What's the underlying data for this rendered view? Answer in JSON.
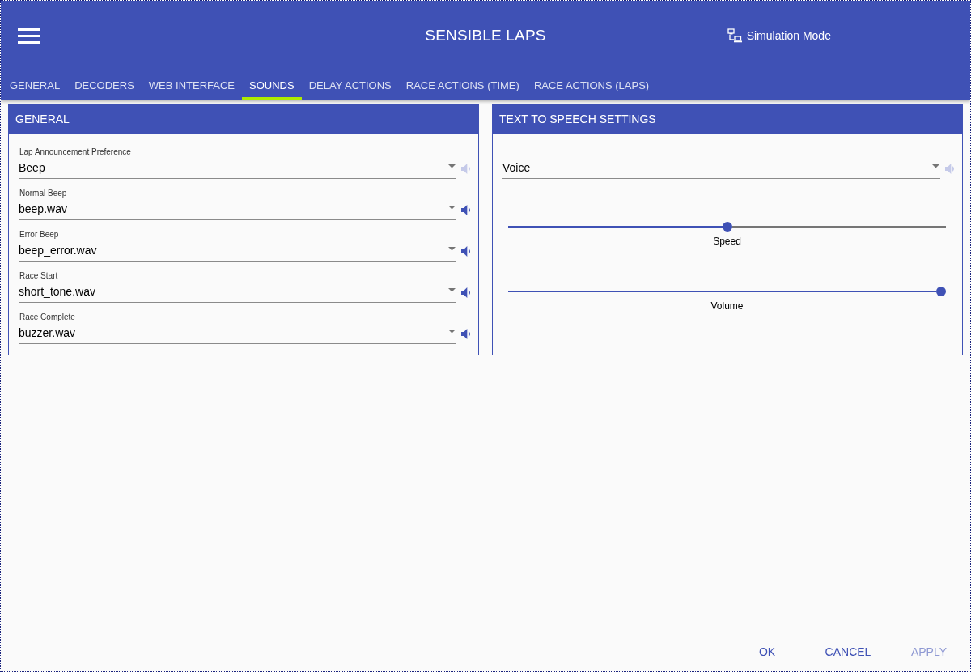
{
  "app_bar": {
    "title": "SENSIBLE LAPS",
    "mode_label": "Simulation Mode"
  },
  "tabs": [
    {
      "label": "GENERAL",
      "selected": false
    },
    {
      "label": "DECODERS",
      "selected": false
    },
    {
      "label": "WEB INTERFACE",
      "selected": false
    },
    {
      "label": "SOUNDS",
      "selected": true
    },
    {
      "label": "DELAY ACTIONS",
      "selected": false
    },
    {
      "label": "RACE ACTIONS (TIME)",
      "selected": false
    },
    {
      "label": "RACE ACTIONS (LAPS)",
      "selected": false
    }
  ],
  "general_card": {
    "title": "GENERAL",
    "fields": [
      {
        "label": "Lap Announcement Preference",
        "value": "Beep",
        "play_disabled": true
      },
      {
        "label": "Normal Beep",
        "value": "beep.wav",
        "play_disabled": false
      },
      {
        "label": "Error Beep",
        "value": "beep_error.wav",
        "play_disabled": false
      },
      {
        "label": "Race Start",
        "value": "short_tone.wav",
        "play_disabled": false
      },
      {
        "label": "Race Complete",
        "value": "buzzer.wav",
        "play_disabled": false
      }
    ]
  },
  "tts_card": {
    "title": "TEXT TO SPEECH SETTINGS",
    "voice": {
      "value": "Voice",
      "play_disabled": true
    },
    "sliders": [
      {
        "label": "Speed",
        "level": 0.5
      },
      {
        "label": "Volume",
        "level": 1
      }
    ]
  },
  "buttons": [
    {
      "label": "OK",
      "disabled": false
    },
    {
      "label": "CANCEL",
      "disabled": false
    },
    {
      "label": "APPLY",
      "disabled": true
    }
  ]
}
